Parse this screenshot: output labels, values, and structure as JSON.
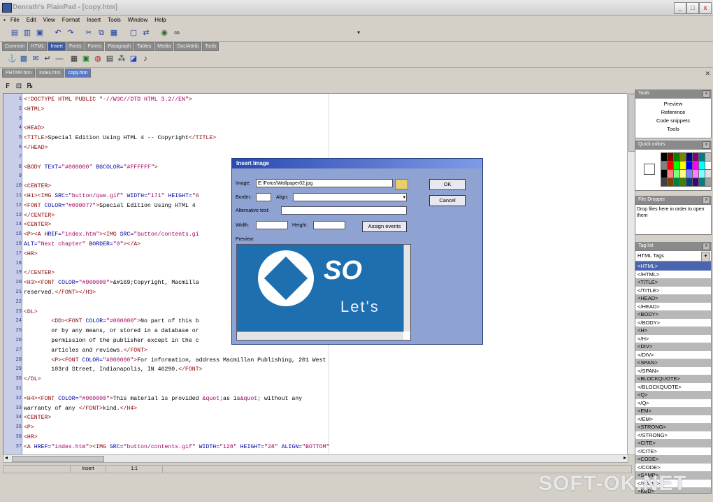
{
  "window": {
    "title": "Denrath's PlainPad - [copy.htm]",
    "min": "_",
    "max": "□",
    "close": "x"
  },
  "menu": [
    "File",
    "Edit",
    "View",
    "Format",
    "Insert",
    "Tools",
    "Window",
    "Help"
  ],
  "palette_tabs": [
    {
      "label": "Common",
      "active": false
    },
    {
      "label": "HTML",
      "active": false
    },
    {
      "label": "Insert",
      "active": true
    },
    {
      "label": "Fonts",
      "active": false
    },
    {
      "label": "Forms",
      "active": false
    },
    {
      "label": "Paragraph",
      "active": false
    },
    {
      "label": "Tables",
      "active": false
    },
    {
      "label": "Media",
      "active": false
    },
    {
      "label": "Doc/Attrib",
      "active": false
    },
    {
      "label": "Tools",
      "active": false
    }
  ],
  "doc_tabs": [
    {
      "label": "PHTMP.htm",
      "active": false
    },
    {
      "label": "index.htm",
      "active": false
    },
    {
      "label": "copy.htm",
      "active": true
    }
  ],
  "editor": {
    "lines": [
      {
        "n": "1",
        "html": "<span class='tag'>&lt;!DOCTYPE HTML PUBLIC</span> <span class='val'>\"-//W3C//DTD HTML 3.2//EN\"</span><span class='tag'>&gt;</span>"
      },
      {
        "n": "2",
        "html": "<span class='tag'>&lt;HTML&gt;</span>"
      },
      {
        "n": "3",
        "html": ""
      },
      {
        "n": "4",
        "html": "<span class='tag'>&lt;HEAD&gt;</span>"
      },
      {
        "n": "5",
        "html": "<span class='tag'>&lt;TITLE&gt;</span>Special Edition Using HTML 4 -- Copyright<span class='tag'>&lt;/TITLE&gt;</span>"
      },
      {
        "n": "6",
        "html": "<span class='tag'>&lt;/HEAD&gt;</span>"
      },
      {
        "n": "7",
        "html": ""
      },
      {
        "n": "8",
        "html": "<span class='tag'>&lt;BODY</span> <span class='attr'>TEXT=</span><span class='val'>\"#000000\"</span> <span class='attr'>BGCOLOR=</span><span class='val'>\"#FFFFFF\"</span><span class='tag'>&gt;</span>"
      },
      {
        "n": "9",
        "html": ""
      },
      {
        "n": "10",
        "html": "<span class='tag'>&lt;CENTER&gt;</span>"
      },
      {
        "n": "11",
        "html": "<span class='tag'>&lt;H1&gt;&lt;IMG</span> <span class='attr'>SRC=</span><span class='val'>\"button/que.gif\"</span> <span class='attr'>WIDTH=</span><span class='val'>\"171\"</span> <span class='attr'>HEIGHT=</span><span class='val'>\"6</span>"
      },
      {
        "n": "12",
        "html": "<span class='tag'>&lt;FONT</span> <span class='attr'>COLOR=</span><span class='val'>\"#000077\"</span><span class='tag'>&gt;</span>Special Edition Using HTML 4"
      },
      {
        "n": "13",
        "html": "<span class='tag'>&lt;/CENTER&gt;</span>"
      },
      {
        "n": "14",
        "html": "<span class='tag'>&lt;CENTER&gt;</span>"
      },
      {
        "n": "15",
        "html": "<span class='tag'>&lt;P&gt;&lt;A</span> <span class='attr'>HREF=</span><span class='val'>\"index.htm\"</span><span class='tag'>&gt;&lt;IMG</span> <span class='attr'>SRC=</span><span class='val'>\"button/contents.gi</span>"
      },
      {
        "n": "16",
        "html": "<span class='attr'>ALT=</span><span class='val'>\"Next chapter\"</span> <span class='attr'>BORDER=</span><span class='val'>\"0\"</span><span class='tag'>&gt;&lt;/A&gt;</span>"
      },
      {
        "n": "17",
        "html": "<span class='tag'>&lt;HR&gt;</span>"
      },
      {
        "n": "18",
        "html": ""
      },
      {
        "n": "19",
        "html": "<span class='tag'>&lt;/CENTER&gt;</span>"
      },
      {
        "n": "20",
        "html": "<span class='tag'>&lt;H3&gt;&lt;FONT</span> <span class='attr'>COLOR=</span><span class='val'>\"#000000\"</span><span class='tag'>&gt;</span>&amp;#169;Copyright, Macmilla"
      },
      {
        "n": "21",
        "html": "reserved.<span class='tag'>&lt;/FONT&gt;&lt;/H3&gt;</span>"
      },
      {
        "n": "22",
        "html": ""
      },
      {
        "n": "23",
        "html": "<span class='tag'>&lt;DL&gt;</span>"
      },
      {
        "n": "24",
        "html": "        <span class='tag'>&lt;DD&gt;&lt;FONT</span> <span class='attr'>COLOR=</span><span class='val'>\"#000000\"</span><span class='tag'>&gt;</span>No part of this b"
      },
      {
        "n": "25",
        "html": "        or by any means, or stored in a database or"
      },
      {
        "n": "26",
        "html": "        permission of the publisher except in the c"
      },
      {
        "n": "27",
        "html": "        articles and reviews.<span class='tag'>&lt;/FONT&gt;</span>"
      },
      {
        "n": "28",
        "html": "        <span class='tag'>&lt;P&gt;&lt;FONT</span> <span class='attr'>COLOR=</span><span class='val'>\"#000000\"</span><span class='tag'>&gt;</span>For information, address Macmillan Publishing, 201 West"
      },
      {
        "n": "29",
        "html": "        103rd Street, Indianapolis, IN 46290.<span class='tag'>&lt;/FONT&gt;</span>"
      },
      {
        "n": "30",
        "html": "<span class='tag'>&lt;/DL&gt;</span>"
      },
      {
        "n": "31",
        "html": ""
      },
      {
        "n": "32",
        "html": "<span class='tag'>&lt;H4&gt;&lt;FONT</span> <span class='attr'>COLOR=</span><span class='val'>\"#000000\"</span><span class='tag'>&gt;</span>This material is provided <span class='val'>&amp;quot;</span>as is<span class='val'>&amp;quot;</span> without any"
      },
      {
        "n": "33",
        "html": "warranty of any <span class='tag'>&lt;/FONT&gt;</span>kind.<span class='tag'>&lt;/H4&gt;</span>"
      },
      {
        "n": "34",
        "html": "<span class='tag'>&lt;CENTER&gt;</span>"
      },
      {
        "n": "35",
        "html": "<span class='tag'>&lt;P&gt;</span>"
      },
      {
        "n": "36",
        "html": "<span class='tag'>&lt;HR&gt;</span>"
      },
      {
        "n": "37",
        "html": "<span class='tag'>&lt;A</span> <span class='attr'>HREF=</span><span class='val'>\"index.htm\"</span><span class='tag'>&gt;&lt;IMG</span> <span class='attr'>SRC=</span><span class='val'>\"button/contents.gif\"</span> <span class='attr'>WIDTH=</span><span class='val'>\"128\"</span> <span class='attr'>HEIGHT=</span><span class='val'>\"28\"</span> <span class='attr'>ALIGN=</span><span class='val'>\"BOTTOM\"</span>"
      }
    ]
  },
  "status": {
    "mode": "Insert",
    "pos": "1:1"
  },
  "panels": {
    "tools": {
      "title": "Tools",
      "items": [
        "Preview",
        "Reference",
        "Code snippets",
        "Tools"
      ]
    },
    "quick_colors": {
      "title": "Quick colors",
      "colors": [
        "#000000",
        "#800000",
        "#008000",
        "#808000",
        "#000080",
        "#800080",
        "#008080",
        "#c0c0c0",
        "#808080",
        "#ff0000",
        "#00ff00",
        "#ffff00",
        "#0000ff",
        "#ff00ff",
        "#00ffff",
        "#ffffff",
        "#000000",
        "#ff8080",
        "#80ff80",
        "#ffff80",
        "#8080ff",
        "#ff80ff",
        "#80ffff",
        "#e0e0e0",
        "#404040",
        "#804000",
        "#008040",
        "#408000",
        "#004080",
        "#400080",
        "#008080",
        "#a0a0a0"
      ]
    },
    "file_dropper": {
      "title": "File Dropper",
      "text": "Drop files here in order to open them"
    },
    "tag_list": {
      "title": "Tag list",
      "select": "HTML Tags",
      "tags": [
        "<HTML>",
        "</HTML>",
        "<TITLE>",
        "</TITLE>",
        "<HEAD>",
        "</HEAD>",
        "<BODY>",
        "</BODY>",
        "<H>",
        "</H>",
        "<DIV>",
        "</DIV>",
        "<SPAN>",
        "</SPAN>",
        "<BLOCKQUOTE>",
        "</BLOCKQUOTE>",
        "<Q>",
        "</Q>",
        "<EM>",
        "</EM>",
        "<STRONG>",
        "</STRONG>",
        "<CITE>",
        "</CITE>",
        "<CODE>",
        "</CODE>",
        "<SAMP>",
        "</SAMP>",
        "<KBD>"
      ]
    }
  },
  "dialog": {
    "title": "Insert Image",
    "image_label": "Image:",
    "image_value": "E:\\Fotos\\Wallpaper02.jpg",
    "border_label": "Border:",
    "align_label": "Align:",
    "alt_label": "Alternative text:",
    "width_label": "Width:",
    "height_label": "Height:",
    "assign_events": "Assign events",
    "preview_label": "Preview:",
    "preview_text_1": "SO",
    "preview_text_2": "Let's",
    "ok": "OK",
    "cancel": "Cancel"
  },
  "watermark": "SOFT-OK.NET"
}
